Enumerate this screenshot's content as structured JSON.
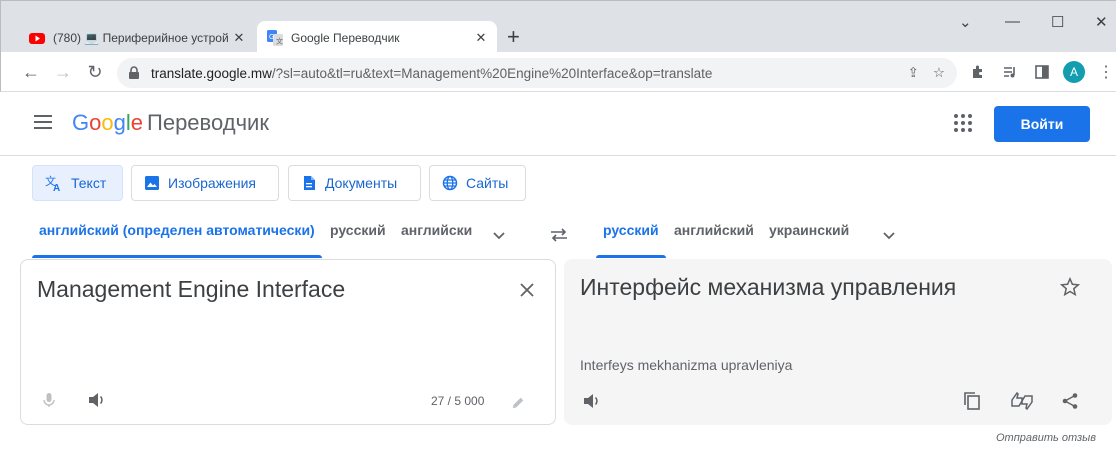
{
  "browser": {
    "tabs": [
      {
        "title": "(780) 💻 Периферийное устрой",
        "favicon": "youtube-icon",
        "active": false
      },
      {
        "title": "Google Переводчик",
        "favicon": "google-translate-icon",
        "active": true
      }
    ],
    "url_host": "translate.google.mw",
    "url_rest": "/?sl=auto&tl=ru&text=Management%20Engine%20Interface&op=translate",
    "avatar_letter": "A",
    "window_controls": [
      "⌄",
      "—",
      "☐",
      "✕"
    ]
  },
  "header": {
    "logo_word": "Google",
    "product": "Переводчик",
    "signin_label": "Войти"
  },
  "modes": [
    {
      "label": "Текст",
      "icon": "translate-icon",
      "selected": true
    },
    {
      "label": "Изображения",
      "icon": "image-icon",
      "selected": false
    },
    {
      "label": "Документы",
      "icon": "document-icon",
      "selected": false
    },
    {
      "label": "Сайты",
      "icon": "globe-icon",
      "selected": false
    }
  ],
  "source_langs": [
    "английский (определен автоматически)",
    "русский",
    "английски"
  ],
  "target_langs": [
    "русский",
    "английский",
    "украинский"
  ],
  "source": {
    "text": "Management Engine Interface",
    "counter": "27 / 5 000"
  },
  "target": {
    "text": "Интерфейс механизма управления",
    "transliteration": "Interfeys mekhanizma upravleniya"
  },
  "feedback_label": "Отправить отзыв",
  "colors": {
    "accent": "#1a73e8",
    "tabstrip": "#dee1e6",
    "target_bg": "#f5f5f5"
  }
}
